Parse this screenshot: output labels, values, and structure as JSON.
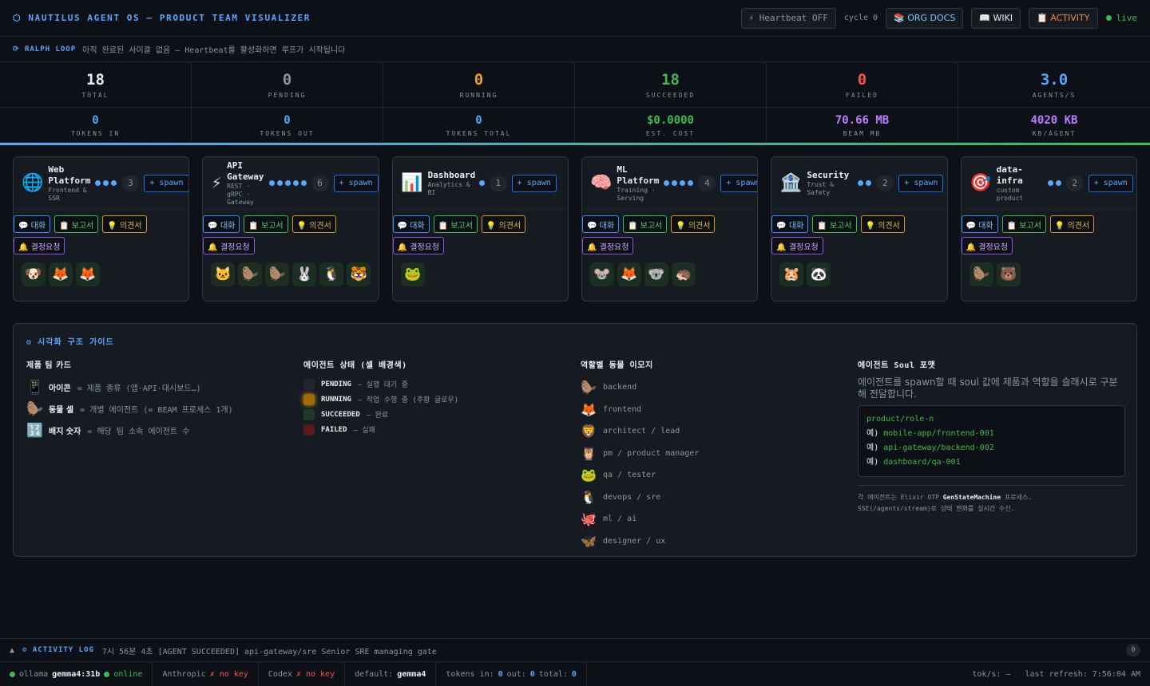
{
  "topbar": {
    "title": "⬡ NAUTILUS AGENT OS — PRODUCT TEAM VISUALIZER",
    "heartbeat": "⚡ Heartbeat OFF",
    "cycle": "cycle 0",
    "org_docs": "📚 ORG DOCS",
    "wiki": "📖 WIKI",
    "activity": "📋 ACTIVITY",
    "live": "live"
  },
  "ralph": {
    "label": "⟳ RALPH LOOP",
    "message": "아직 완료된 사이클 없음 — Heartbeat를 활성화하면 루프가 시작됩니다"
  },
  "stats": [
    {
      "value": "18",
      "label": "TOTAL",
      "color": "white"
    },
    {
      "value": "0",
      "label": "PENDING",
      "color": "gray"
    },
    {
      "value": "0",
      "label": "RUNNING",
      "color": "orange"
    },
    {
      "value": "18",
      "label": "SUCCEEDED",
      "color": "green"
    },
    {
      "value": "0",
      "label": "FAILED",
      "color": "red"
    },
    {
      "value": "3.0",
      "label": "AGENTS/S",
      "color": "blue"
    },
    {
      "value": "0",
      "label": "TOKENS IN",
      "color": "blue"
    },
    {
      "value": "0",
      "label": "TOKENS OUT",
      "color": "blue"
    },
    {
      "value": "0",
      "label": "TOKENS TOTAL",
      "color": "blue"
    },
    {
      "value": "$0.0000",
      "label": "EST. COST",
      "color": "green"
    },
    {
      "value": "70.66 MB",
      "label": "BEAM MB",
      "color": "purple"
    },
    {
      "value": "4020 KB",
      "label": "KB/AGENT",
      "color": "purple"
    }
  ],
  "team_buttons": {
    "chat": "💬 대화",
    "report": "📋 보고서",
    "opinion": "💡 의견서",
    "decide": "🔔 결정요청",
    "spawn": "+ spawn"
  },
  "teams": [
    {
      "icon": "🌐",
      "name": "Web Platform",
      "sub": "Frontend & SSR",
      "dots": 3,
      "count": "3",
      "agents": [
        "🐶",
        "🦊",
        "🦊"
      ]
    },
    {
      "icon": "⚡",
      "name": "API Gateway",
      "sub": "REST · gRPC · Gateway",
      "dots": 5,
      "count": "6",
      "agents": [
        "🐱",
        "🦫",
        "🦫",
        "🐰",
        "🐧",
        "🐯"
      ]
    },
    {
      "icon": "📊",
      "name": "Dashboard",
      "sub": "Analytics & BI",
      "dots": 1,
      "count": "1",
      "agents": [
        "🐸"
      ]
    },
    {
      "icon": "🧠",
      "name": "ML Platform",
      "sub": "Training · Serving",
      "dots": 4,
      "count": "4",
      "agents": [
        "🐭",
        "🦊",
        "🐨",
        "🦔"
      ]
    },
    {
      "icon": "🏦",
      "name": "Security",
      "sub": "Trust & Safety",
      "dots": 2,
      "count": "2",
      "agents": [
        "🐹",
        "🐼"
      ]
    },
    {
      "icon": "🎯",
      "name": "data-infra",
      "sub": "custom product",
      "dots": 2,
      "count": "2",
      "agents": [
        "🦫",
        "🐻"
      ]
    }
  ],
  "guide": {
    "title": "⚙ 시각화 구조 가이드",
    "col1": {
      "heading": "제품 팀 카드",
      "items": [
        {
          "icon": "📱",
          "term": "아이콘",
          "desc": "= 제품 종류 (앱·API·대시보드…)"
        },
        {
          "icon": "🦫",
          "term": "동물 셀",
          "desc": "= 개별 에이전트 (= BEAM 프로세스 1개)"
        },
        {
          "icon": "🔢",
          "term": "배지 숫자",
          "desc": "= 해당 팀 소속 에이전트 수"
        }
      ]
    },
    "col2": {
      "heading": "에이전트 상태 (셀 배경색)",
      "items": [
        {
          "color": "#21262d",
          "state": "PENDING",
          "desc": "— 실행 대기 중"
        },
        {
          "color": "#9e6a03",
          "state": "RUNNING",
          "desc": "— 작업 수행 중 (주황 글로우)"
        },
        {
          "color": "#1c3a26",
          "state": "SUCCEEDED",
          "desc": "— 완료"
        },
        {
          "color": "#5a1a1a",
          "state": "FAILED",
          "desc": "— 실패"
        }
      ]
    },
    "col3": {
      "heading": "역할별 동물 이모지",
      "items": [
        {
          "icon": "🦫",
          "role": "backend"
        },
        {
          "icon": "🦊",
          "role": "frontend"
        },
        {
          "icon": "🦁",
          "role": "architect / lead"
        },
        {
          "icon": "🦉",
          "role": "pm / product manager"
        },
        {
          "icon": "🐸",
          "role": "qa / tester"
        },
        {
          "icon": "🐧",
          "role": "devops / sre"
        },
        {
          "icon": "🐙",
          "role": "ml / ai"
        },
        {
          "icon": "🦋",
          "role": "designer / ux"
        }
      ]
    },
    "col4": {
      "heading": "에이전트 Soul 포맷",
      "desc": "에이전트를 spawn할 때 soul 값에 제품과 역할을 슬래시로 구분해 전달합니다.",
      "code_line1": "product/role-n",
      "examples": [
        {
          "prefix": "예)",
          "value": "mobile-app/frontend-001"
        },
        {
          "prefix": "예)",
          "value": "api-gateway/backend-002"
        },
        {
          "prefix": "예)",
          "value": "dashboard/qa-001"
        }
      ],
      "note1_a": "각 에이전트는 Elixir OTP",
      "note1_b": "GenStateMachine",
      "note1_c": "프로세스.",
      "note2": "SSE(/agents/stream)로 상태 변화를 실시간 수신."
    }
  },
  "activity_log": {
    "label": "⚙ ACTIVITY LOG",
    "toggle": "▲",
    "last": "7시 56분 4초 [AGENT SUCCEEDED] api-gateway/sre Senior SRE managing gate",
    "count": "0"
  },
  "statusbar": {
    "ollama_label": "ollama",
    "ollama_model": "gemma4:31b",
    "ollama_status": "online",
    "anthropic_label": "Anthropic",
    "anthropic_status": "✗ no key",
    "codex_label": "Codex",
    "codex_status": "✗ no key",
    "default_label": "default:",
    "default_value": "gemma4",
    "tokens_label_in": "tokens in:",
    "tokens_in": "0",
    "tokens_label_out": "out:",
    "tokens_out": "0",
    "tokens_label_total": "total:",
    "tokens_total": "0",
    "toks": "tok/s: —",
    "refresh": "last refresh: 7:56:04 AM"
  }
}
